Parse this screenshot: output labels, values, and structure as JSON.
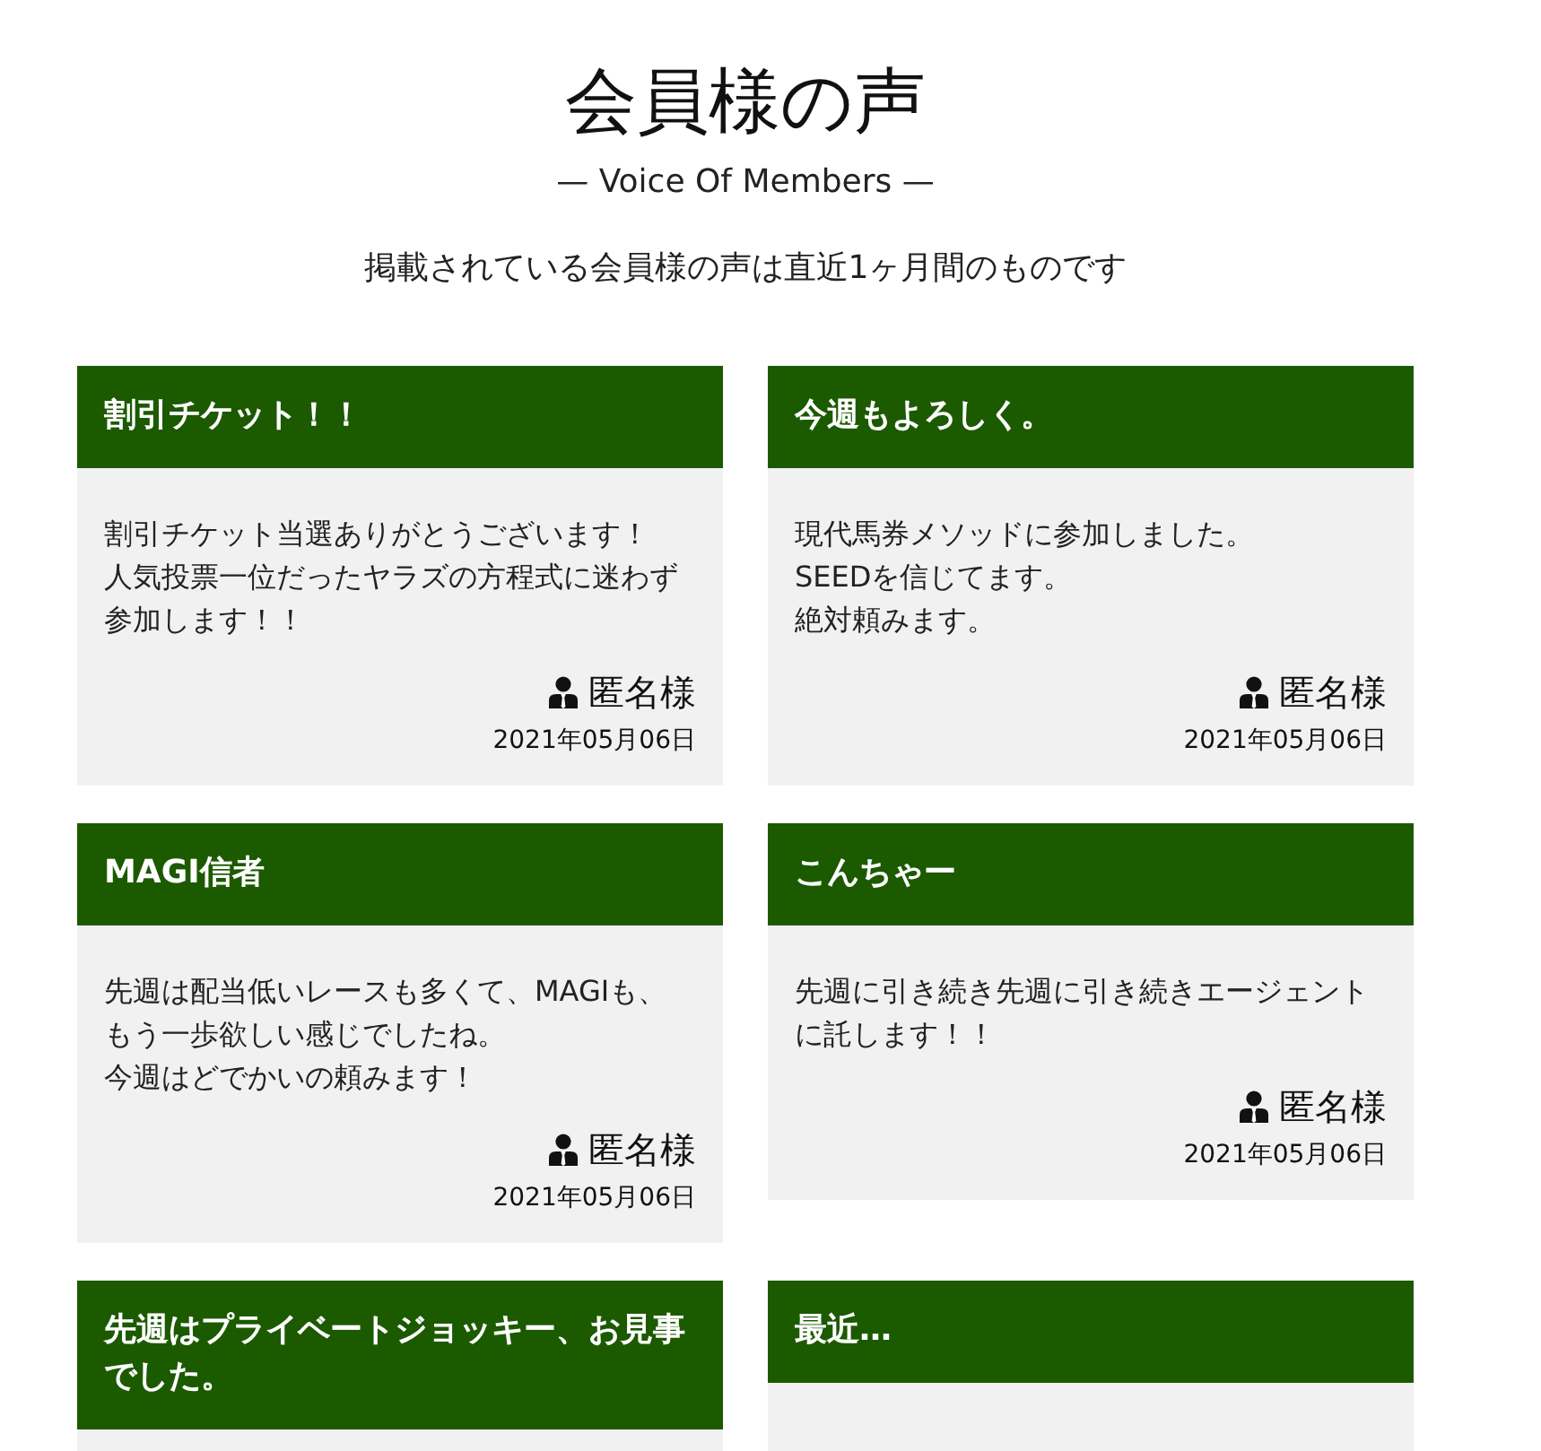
{
  "page": {
    "title": "会員様の声",
    "subtitle": "— Voice Of Members —",
    "note": "掲載されている会員様の声は直近1ヶ月間のものです"
  },
  "reviews": [
    {
      "title": "割引チケット！！",
      "comment": [
        "割引チケット当選ありがとうございます！",
        "人気投票一位だったヤラズの方程式に迷わず",
        "参加します！！"
      ],
      "author": "匿名様",
      "date": "2021年05月06日"
    },
    {
      "title": "今週もよろしく。",
      "comment": [
        "現代馬券メソッドに参加しました。",
        "SEEDを信じてます。",
        "絶対頼みます。"
      ],
      "author": "匿名様",
      "date": "2021年05月06日"
    },
    {
      "title": "MAGI信者",
      "comment": [
        "先週は配当低いレースも多くて、MAGIも、",
        "もう一歩欲しい感じでしたね。",
        "今週はどでかいの頼みます！"
      ],
      "author": "匿名様",
      "date": "2021年05月06日"
    },
    {
      "title": "こんちゃー",
      "comment": [
        "先週に引き続き先週に引き続きエージェント",
        "に託します！！"
      ],
      "author": "匿名様",
      "date": "2021年05月06日"
    },
    {
      "title": "先週はプライベートジョッキー、お見事でした。"
    },
    {
      "title": "最近…"
    }
  ]
}
